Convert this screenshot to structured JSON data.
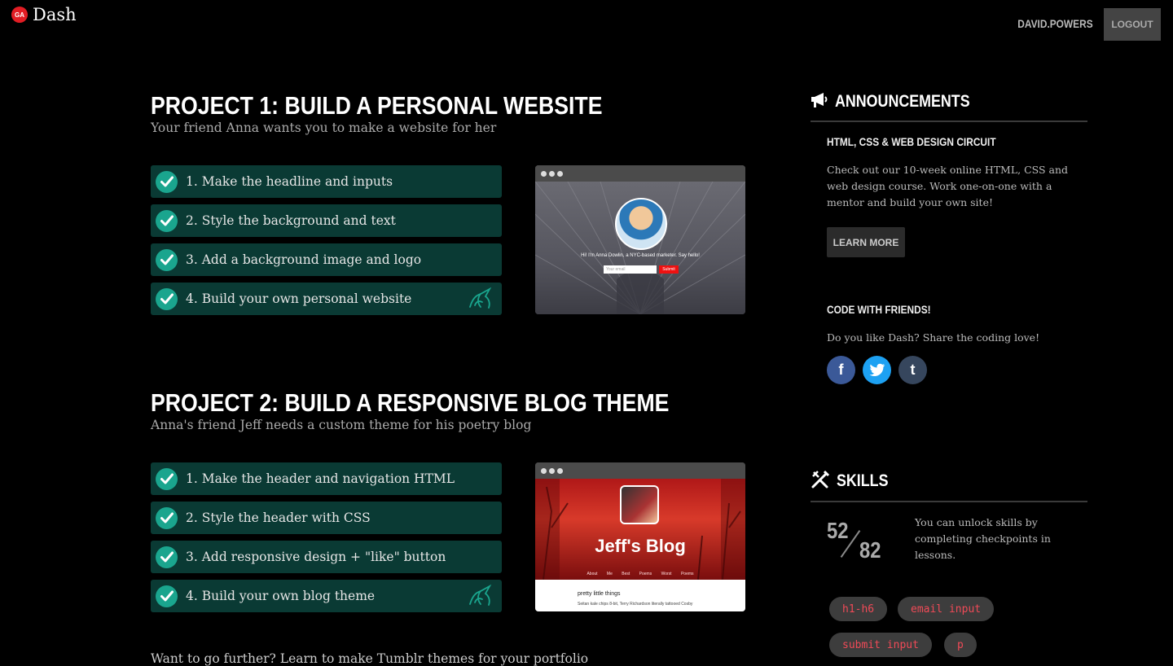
{
  "header": {
    "logo_badge": "GA",
    "logo_text": "Dash",
    "username": "DAVID.POWERS",
    "logout_label": "LOGOUT"
  },
  "projects": [
    {
      "title": "PROJECT 1: BUILD A PERSONAL WEBSITE",
      "subtitle": "Your friend Anna wants you to make a website for her",
      "steps": [
        {
          "label": "1. Make the headline and inputs",
          "completed": true
        },
        {
          "label": "2. Style the background and text",
          "completed": true
        },
        {
          "label": "3. Add a background image and logo",
          "completed": true
        },
        {
          "label": "4. Build your own personal website",
          "completed": true,
          "badge_icon": "unicorn-icon"
        }
      ],
      "preview": {
        "tagline": "Hi! I'm Anna Dowlin, a NYC-based marketer. Say hello!",
        "input_placeholder": "Your email",
        "submit_label": "Submit"
      }
    },
    {
      "title": "PROJECT 2: BUILD A RESPONSIVE BLOG THEME",
      "subtitle": "Anna's friend Jeff needs a custom theme for his poetry blog",
      "steps": [
        {
          "label": "1. Make the header and navigation HTML",
          "completed": true
        },
        {
          "label": "2. Style the header with CSS",
          "completed": true
        },
        {
          "label": "3. Add responsive design + \"like\" button",
          "completed": true
        },
        {
          "label": "4. Build your own blog theme",
          "completed": true,
          "badge_icon": "unicorn-icon"
        }
      ],
      "preview": {
        "blog_title": "Jeff's Blog",
        "nav_items": [
          "About Me",
          "Best Poems",
          "Worst Poems"
        ],
        "post_title": "pretty little things",
        "post_text": "Seitan kale chips 8-bit, Terry Richardson literally tattooed Cosby"
      }
    }
  ],
  "bottom_text": "Want to go further? Learn to make Tumblr themes for your portfolio",
  "announcements": {
    "heading": "ANNOUNCEMENTS",
    "item_title": "HTML, CSS & WEB DESIGN CIRCUIT",
    "item_body": "Check out our 10-week online HTML, CSS and web design course. Work one-on-one with a mentor and build your own site!",
    "cta_label": "LEARN MORE",
    "share_title": "CODE WITH FRIENDS!",
    "share_body": "Do you like Dash? Share the coding love!",
    "social": [
      {
        "icon": "facebook-icon",
        "glyph": "f",
        "color": "#3b5998"
      },
      {
        "icon": "twitter-icon",
        "glyph": "t",
        "color": "#1da1f2"
      },
      {
        "icon": "tumblr-icon",
        "glyph": "t",
        "color": "#36465d"
      }
    ]
  },
  "skills": {
    "heading": "SKILLS",
    "completed": "52",
    "total": "82",
    "description": "You can unlock skills by completing checkpoints in lessons.",
    "tags": [
      "h1-h6",
      "email input",
      "submit input",
      "p"
    ]
  },
  "colors": {
    "background": "#000000",
    "step_bg": "#0a3a34",
    "check": "#1aa58e",
    "logo_red": "#e21d24",
    "skill_tag_text": "#f04a57"
  }
}
